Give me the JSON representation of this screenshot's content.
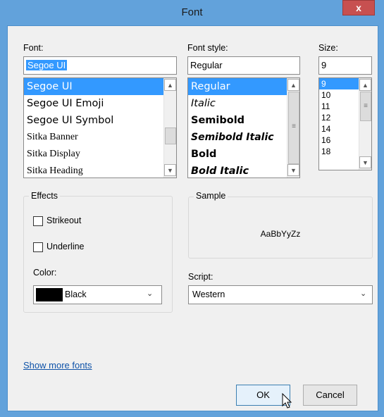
{
  "window": {
    "title": "Font",
    "close_glyph": "x"
  },
  "font": {
    "label": "Font:",
    "value": "Segoe UI",
    "items": [
      "Segoe UI",
      "Segoe UI Emoji",
      "Segoe UI Symbol",
      "Sitka Banner",
      "Sitka Display",
      "Sitka Heading"
    ],
    "selected": "Segoe UI"
  },
  "style": {
    "label": "Font style:",
    "value": "Regular",
    "items": [
      "Regular",
      "Italic",
      "Semibold",
      "Semibold Italic",
      "Bold",
      "Bold Italic"
    ],
    "selected": "Regular"
  },
  "size": {
    "label": "Size:",
    "value": "9",
    "items": [
      "9",
      "10",
      "11",
      "12",
      "14",
      "16",
      "18"
    ],
    "selected": "9"
  },
  "effects": {
    "label": "Effects",
    "strikeout": "Strikeout",
    "underline": "Underline",
    "color_label": "Color:",
    "color_value": "Black",
    "color_swatch": "#000000"
  },
  "sample": {
    "label": "Sample",
    "text": "AaBbYyZz"
  },
  "script": {
    "label": "Script:",
    "value": "Western"
  },
  "links": {
    "show_more": "Show more fonts"
  },
  "buttons": {
    "ok": "OK",
    "cancel": "Cancel"
  },
  "colors": {
    "titlebar": "#62a2db",
    "selection": "#3399ff",
    "close": "#c75050"
  }
}
